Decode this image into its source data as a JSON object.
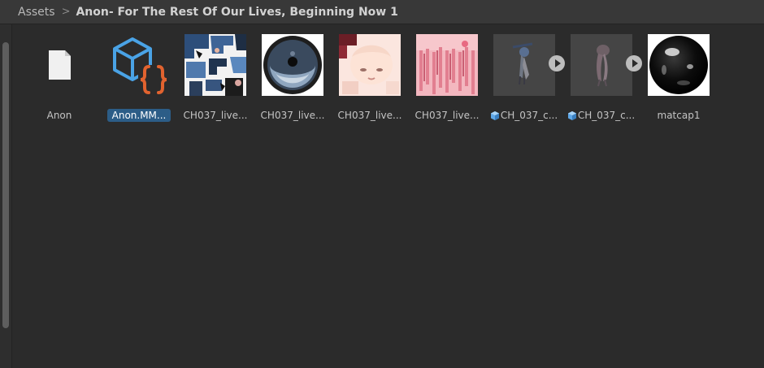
{
  "breadcrumb": {
    "root": "Assets",
    "separator": ">",
    "current": "Anon- For The Rest Of Our Lives, Beginning Now 1"
  },
  "assets": [
    {
      "label": "Anon",
      "icon": "document-icon"
    },
    {
      "label": "Anon.MM...",
      "icon": "script-cube-icon",
      "selected": true
    },
    {
      "label": "CH037_live...",
      "icon": "texture-thumbnail"
    },
    {
      "label": "CH037_live...",
      "icon": "texture-thumbnail"
    },
    {
      "label": "CH037_live...",
      "icon": "texture-thumbnail"
    },
    {
      "label": "CH037_live...",
      "icon": "texture-thumbnail"
    },
    {
      "label": "CH_037_c...",
      "icon": "model-prefab-icon",
      "expandable": true
    },
    {
      "label": "CH_037_c...",
      "icon": "model-prefab-icon",
      "expandable": true
    },
    {
      "label": "matcap1",
      "icon": "material-sphere-thumbnail"
    }
  ],
  "colors": {
    "background": "#2b2b2b",
    "header": "#383838",
    "selection": "#2c5d87",
    "script_blue": "#4aa3e6",
    "script_orange": "#e2632f"
  }
}
